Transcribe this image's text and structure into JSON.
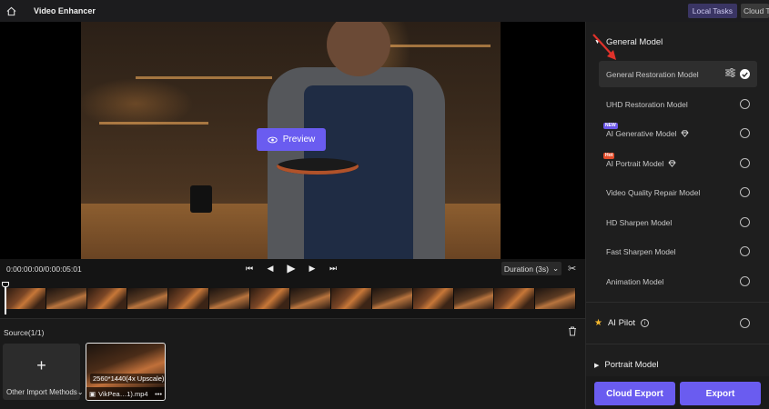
{
  "header": {
    "title": "Video Enhancer",
    "local_tasks": "Local Tasks",
    "cloud_tasks": "Cloud T"
  },
  "video": {
    "preview_label": "Preview"
  },
  "controls": {
    "timecode": "0:00:00:00/0:00:05:01",
    "duration_label": "Duration (3s)"
  },
  "timeline": {
    "thumbnail_count": 14
  },
  "source": {
    "title": "Source(1/1)",
    "import_label": "Other Import Methods",
    "clip": {
      "resolution": "2560*1440(4x Upscale)",
      "filename": "VikPea…1).mp4"
    }
  },
  "panel": {
    "general_model_header": "General Model",
    "models": [
      {
        "name": "General Restoration Model",
        "selected": true
      },
      {
        "name": "UHD Restoration Model"
      },
      {
        "name": "AI Generative Model",
        "badge": "NEW"
      },
      {
        "name": "AI Portrait Model",
        "badge": "Hot"
      },
      {
        "name": "Video Quality Repair Model"
      },
      {
        "name": "HD Sharpen Model"
      },
      {
        "name": "Fast Sharpen Model"
      },
      {
        "name": "Animation Model"
      }
    ],
    "ai_pilot_label": "AI Pilot",
    "portrait_model_header": "Portrait Model",
    "cloud_export_label": "Cloud Export",
    "export_label": "Export"
  },
  "colors": {
    "accent": "#6a5cf0",
    "background": "#141414",
    "panel": "#1e1e1e"
  },
  "icons": [
    "home-icon",
    "eye-icon",
    "skip-start-icon",
    "step-back-icon",
    "play-icon",
    "step-forward-icon",
    "skip-end-icon",
    "chevron-down-icon",
    "scissors-icon",
    "trash-icon",
    "plus-icon",
    "film-icon",
    "more-icon",
    "settings-sliders-icon",
    "checkmark-icon",
    "diamond-icon",
    "star-icon",
    "info-icon",
    "triangle-down-icon",
    "triangle-right-icon",
    "red-arrow-annotation"
  ]
}
